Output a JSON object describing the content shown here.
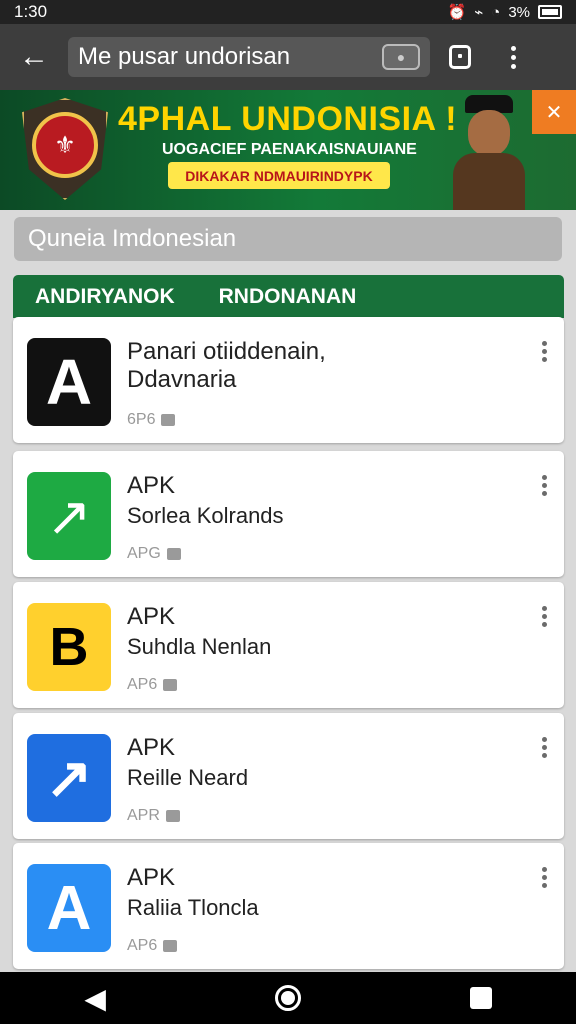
{
  "status_bar": {
    "time": "1:30",
    "battery_text": "3%"
  },
  "toolbar": {
    "search_value": "Me pusar undorisan"
  },
  "banner": {
    "title": "4PHAL UNDONISIA !",
    "subtitle": "UOGACIEF PAENAKAISNAUIANE",
    "button_label": "DIKAKAR NDMAUIRINDYPK",
    "brand_colors": {
      "green": "#137a38",
      "yellow": "#ffd400",
      "red": "#b91b21"
    }
  },
  "query": {
    "value": "Quneia Imdonesian"
  },
  "tabs": {
    "items": [
      "ANDIRYANOK",
      "RNDONANAN"
    ]
  },
  "results": [
    {
      "title": "Panari otiiddenain,\nDdavnaria",
      "subtitle": "",
      "meta": "6P6",
      "icon": "letter-a-icon",
      "icon_letter": "A",
      "icon_color": "#e01d1d"
    },
    {
      "title": "APK",
      "subtitle": "Sorlea Kolrands",
      "meta": "APG",
      "icon": "green-circle-arrow-icon",
      "icon_letter": "↗",
      "icon_color": "#1eaa43"
    },
    {
      "title": "APK",
      "subtitle": "Suhdla Nenlan",
      "meta": "AP6",
      "icon": "yellow-b-icon",
      "icon_letter": "B",
      "icon_color": "#ffd02d"
    },
    {
      "title": "APK",
      "subtitle": "Reille Neard",
      "meta": "APR",
      "icon": "blue-arrow-icon",
      "icon_letter": "↗",
      "icon_color": "#1f6ee0"
    },
    {
      "title": "APK",
      "subtitle": "Raliia Tloncla",
      "meta": "AP6",
      "icon": "blue-a-icon",
      "icon_letter": "A",
      "icon_color": "#2a8ef4"
    }
  ],
  "navigation": {
    "back_icon": "back-triangle-icon",
    "home_icon": "home-circle-icon",
    "recents_icon": "recent-apps-square-icon"
  }
}
